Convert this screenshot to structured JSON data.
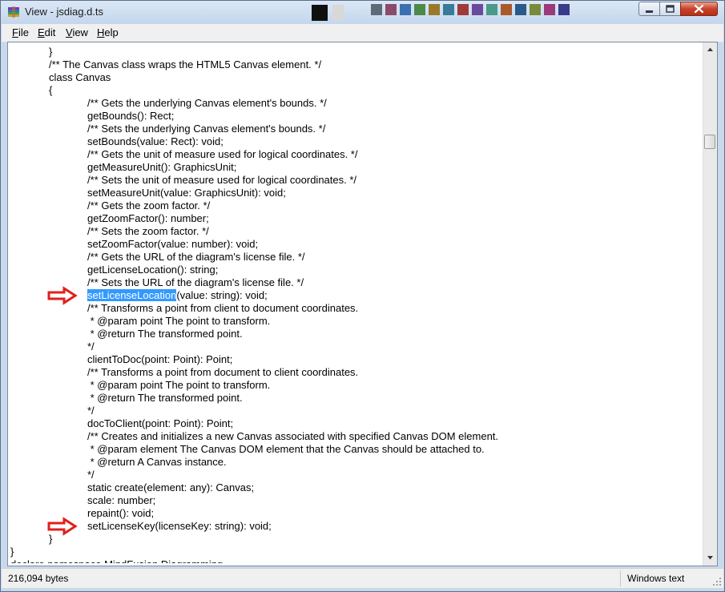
{
  "window": {
    "title": "View - jsdiag.d.ts"
  },
  "menu": [
    {
      "key": "F",
      "rest": "ile"
    },
    {
      "key": "E",
      "rest": "dit"
    },
    {
      "key": "V",
      "rest": "iew"
    },
    {
      "key": "H",
      "rest": "elp"
    }
  ],
  "editor": {
    "lines": [
      {
        "indent": 1,
        "text": "}"
      },
      {
        "indent": 1,
        "text": "/** The Canvas class wraps the HTML5 Canvas element. */"
      },
      {
        "indent": 1,
        "text": "class Canvas"
      },
      {
        "indent": 1,
        "text": "{"
      },
      {
        "indent": 2,
        "text": "/** Gets the underlying Canvas element's bounds. */"
      },
      {
        "indent": 2,
        "text": "getBounds(): Rect;"
      },
      {
        "indent": 2,
        "text": "/** Sets the underlying Canvas element's bounds. */"
      },
      {
        "indent": 2,
        "text": "setBounds(value: Rect): void;"
      },
      {
        "indent": 2,
        "text": "/** Gets the unit of measure used for logical coordinates. */"
      },
      {
        "indent": 2,
        "text": "getMeasureUnit(): GraphicsUnit;"
      },
      {
        "indent": 2,
        "text": "/** Sets the unit of measure used for logical coordinates. */"
      },
      {
        "indent": 2,
        "text": "setMeasureUnit(value: GraphicsUnit): void;"
      },
      {
        "indent": 2,
        "text": "/** Gets the zoom factor. */"
      },
      {
        "indent": 2,
        "text": "getZoomFactor(): number;"
      },
      {
        "indent": 2,
        "text": "/** Sets the zoom factor. */"
      },
      {
        "indent": 2,
        "text": "setZoomFactor(value: number): void;"
      },
      {
        "indent": 2,
        "text": "/** Gets the URL of the diagram's license file. */"
      },
      {
        "indent": 2,
        "text": "getLicenseLocation(): string;"
      },
      {
        "indent": 2,
        "text": "/** Sets the URL of the diagram's license file. */"
      },
      {
        "indent": 2,
        "selected": "setLicenseLocation",
        "text": "(value: string): void;",
        "arrow": true
      },
      {
        "indent": 2,
        "text": "/** Transforms a point from client to document coordinates."
      },
      {
        "indent": 2,
        "text": " * @param point The point to transform."
      },
      {
        "indent": 2,
        "text": " * @return The transformed point."
      },
      {
        "indent": 2,
        "text": "*/"
      },
      {
        "indent": 2,
        "text": "clientToDoc(point: Point): Point;"
      },
      {
        "indent": 2,
        "text": "/** Transforms a point from document to client coordinates."
      },
      {
        "indent": 2,
        "text": " * @param point The point to transform."
      },
      {
        "indent": 2,
        "text": " * @return The transformed point."
      },
      {
        "indent": 2,
        "text": "*/"
      },
      {
        "indent": 2,
        "text": "docToClient(point: Point): Point;"
      },
      {
        "indent": 2,
        "text": "/** Creates and initializes a new Canvas associated with specified Canvas DOM element."
      },
      {
        "indent": 2,
        "text": " * @param element The Canvas DOM element that the Canvas should be attached to."
      },
      {
        "indent": 2,
        "text": " * @return A Canvas instance."
      },
      {
        "indent": 2,
        "text": "*/"
      },
      {
        "indent": 2,
        "text": "static create(element: any): Canvas;"
      },
      {
        "indent": 2,
        "text": "scale: number;"
      },
      {
        "indent": 2,
        "text": "repaint(): void;"
      },
      {
        "indent": 2,
        "text": "setLicenseKey(licenseKey: string): void;",
        "arrow": true
      },
      {
        "indent": 1,
        "text": "}"
      },
      {
        "indent": 0,
        "text": "}"
      },
      {
        "indent": 0,
        "text": "declare namespace MindFusion.Diagramming"
      }
    ]
  },
  "status": {
    "size": "216,094 bytes",
    "encoding": "Windows text"
  },
  "colors": {
    "selection": "#3399ff",
    "arrow": "#e0201c"
  }
}
